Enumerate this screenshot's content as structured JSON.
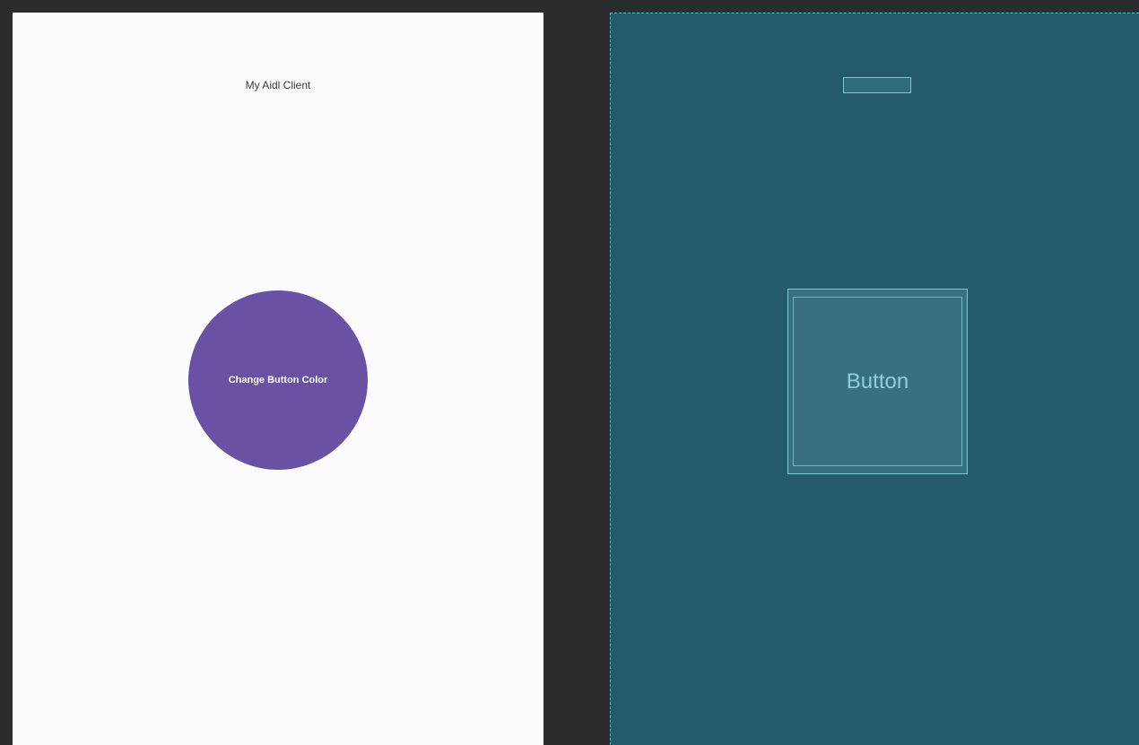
{
  "design_view": {
    "title": "My Aidl Client",
    "button_label": "Change Button Color",
    "button_color": "#6951a3",
    "background_color": "#fefbfe"
  },
  "blueprint_view": {
    "button_label": "Button",
    "background_color": "#235b6c",
    "outline_color": "#7ec7d3"
  },
  "editor_background": "#2b2c30"
}
